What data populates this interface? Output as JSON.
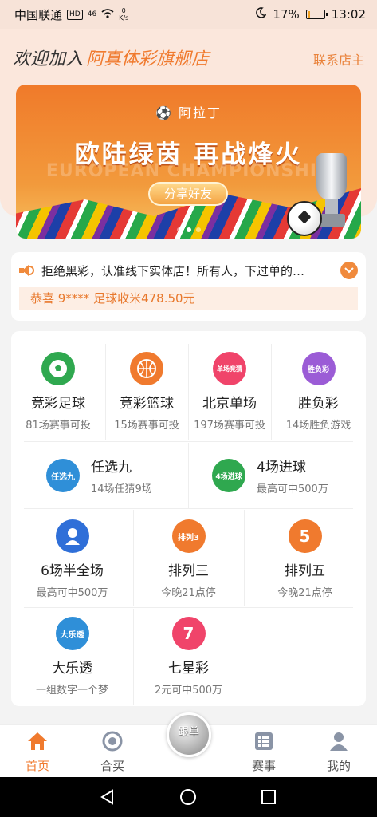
{
  "status_bar": {
    "carrier": "中国联通",
    "hd": "HD",
    "signal": "46",
    "speed_value": "0",
    "speed_unit": "K/s",
    "battery": "17%",
    "time": "13:02"
  },
  "header": {
    "welcome_prefix": "欢迎加入",
    "shop_name": "阿真体彩旗舰店",
    "contact_label": "联系店主"
  },
  "banner": {
    "brand": "阿拉丁",
    "ghost_text": "EUROPEAN CHAMPIONSHIP",
    "headline": "欧陆绿茵 再战烽火",
    "share_label": "分享好友",
    "slide_count": 3,
    "active_slide": 2
  },
  "notice": {
    "text": "拒绝黑彩，认准线下实体店！所有人，下过单的…",
    "winner": "恭喜 9**** 足球收米478.50元"
  },
  "games": [
    {
      "name": "竞彩足球",
      "sub": "81场赛事可投",
      "icon": "football-icon",
      "color": "#2fa84f"
    },
    {
      "name": "竞彩篮球",
      "sub": "15场赛事可投",
      "icon": "basketball-icon",
      "color": "#f07a2e"
    },
    {
      "name": "北京单场",
      "sub": "197场赛事可投",
      "icon": "beijing-single-icon",
      "color": "#f0446a",
      "badge": "单场竞猜"
    },
    {
      "name": "胜负彩",
      "sub": "14场胜负游戏",
      "icon": "win-lose-icon",
      "color": "#9b5cd6",
      "badge": "胜负彩"
    },
    {
      "name": "任选九",
      "sub": "14场任猜9场",
      "icon": "pick-nine-icon",
      "color": "#2f8fd8",
      "badge": "任选九"
    },
    {
      "name": "4场进球",
      "sub": "最高可中500万",
      "icon": "four-goals-icon",
      "color": "#2fa84f",
      "badge": "4场进球"
    },
    {
      "name": "6场半全场",
      "sub": "最高可中500万",
      "icon": "six-halffull-icon",
      "color": "#2f6fd8"
    },
    {
      "name": "排列三",
      "sub": "今晚21点停",
      "icon": "pailie-three-icon",
      "color": "#f07a2e",
      "badge": "排列3"
    },
    {
      "name": "排列五",
      "sub": "今晚21点停",
      "icon": "pailie-five-icon",
      "color": "#f07a2e",
      "badge": "5"
    },
    {
      "name": "大乐透",
      "sub": "一组数字一个梦",
      "icon": "lotto-icon",
      "color": "#2f8fd8",
      "badge": "大乐透"
    },
    {
      "name": "七星彩",
      "sub": "2元可中500万",
      "icon": "seven-star-icon",
      "color": "#f0446a",
      "badge": "7"
    }
  ],
  "bottom_nav": {
    "items": [
      {
        "label": "首页",
        "icon": "home-icon",
        "active": true
      },
      {
        "label": "合买",
        "icon": "target-icon",
        "active": false
      },
      {
        "label": "赛事",
        "icon": "list-icon",
        "active": false
      },
      {
        "label": "我的",
        "icon": "user-icon",
        "active": false
      }
    ],
    "center_label": "跟单",
    "accent": "#f07a2e"
  }
}
